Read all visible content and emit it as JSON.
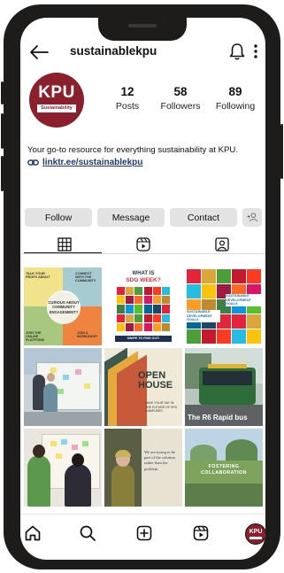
{
  "header": {
    "username": "sustainablekpu"
  },
  "profile": {
    "avatar": {
      "logo_text": "KPU",
      "logo_subtext": "Sustainability",
      "brand_color": "#8b1f2c"
    },
    "stats": [
      {
        "number": "12",
        "label": "Posts"
      },
      {
        "number": "58",
        "label": "Followers"
      },
      {
        "number": "89",
        "label": "Following"
      }
    ],
    "bio": "Your go-to resource for everything sustainability at KPU.",
    "link": "linktr.ee/sustainablekpu"
  },
  "actions": {
    "follow": "Follow",
    "message": "Message",
    "contact": "Contact"
  },
  "tabs": [
    {
      "icon": "grid-icon",
      "active": true
    },
    {
      "icon": "reels-icon",
      "active": false
    },
    {
      "icon": "tagged-icon",
      "active": false
    }
  ],
  "posts": {
    "p1": {
      "center": "CURIOUS ABOUT COMMUNITY ENGAGEMENT?",
      "q": [
        "TALK YOUR PROFS ABOUT",
        "CONNECT WITH THE COMMUNITY",
        "JOIN THE ONLINE PLATFORM",
        "JOIN A WORKSHOP"
      ]
    },
    "p2": {
      "title_line1": "WHAT IS",
      "title_line2": "SDG WEEK?",
      "footer": "SWIPE TO FIND OUT!"
    },
    "p3": {
      "goal_title_left": "SUSTAINABLE DEVELOPMENT GOALS",
      "goal_title_right": "SUSTAINABLE DEVELOPMENT GOALS"
    },
    "p5": {
      "line1": "OPEN",
      "line2": "HOUSE",
      "small": "HAVE YOUR SAY IN THE FUTURE OF KPU CAMPUSES"
    },
    "p6": {
      "caption": "The R6 Rapid bus"
    },
    "p8": {
      "quote": "We are trying to be part of the solution rather than the problem."
    },
    "p9": {
      "caption": "FOSTERING COLLABORATION"
    }
  },
  "bottom_nav": [
    "home-icon",
    "search-icon",
    "create-icon",
    "reels-icon",
    "profile-avatar"
  ]
}
